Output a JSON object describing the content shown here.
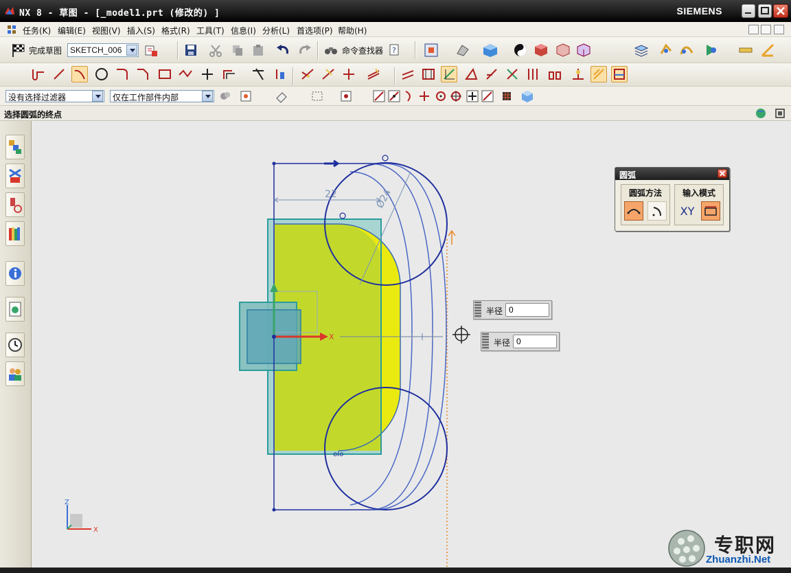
{
  "window": {
    "title": "NX 8 - 草图 - [_model1.prt  (修改的) ]",
    "brand": "SIEMENS"
  },
  "menubar": {
    "items": [
      "任务(K)",
      "编辑(E)",
      "视图(V)",
      "插入(S)",
      "格式(R)",
      "工具(T)",
      "信息(I)",
      "分析(L)",
      "首选项(P)",
      "帮助(H)"
    ]
  },
  "toolbar": {
    "finish_sketch_label": "完成草图",
    "sketch_name": "SKETCH_006",
    "command_finder_label": "命令查找器"
  },
  "selection_bar": {
    "type_filter": "没有选择过滤器",
    "scope": "仅在工作部件内部"
  },
  "cue_line": {
    "text": "选择圆弧的终点"
  },
  "arc_dialog": {
    "title": "圆弧",
    "group_method": "圆弧方法",
    "group_input": "输入模式",
    "xy_label": "XY"
  },
  "radius_inputs": [
    {
      "label": "半径",
      "value": "0"
    },
    {
      "label": "半径",
      "value": "0"
    }
  ],
  "sketch": {
    "dim_horizontal": "22",
    "dim_diameter": "Ø24",
    "axis_x": "X",
    "triad_z": "Z",
    "triad_x": "X"
  },
  "watermark": {
    "cn": "专职网",
    "en": "Zhuanzhi.Net"
  },
  "colors": {
    "accent_orange": "#f6a56a",
    "sketch_blue": "#1f2f9e",
    "body_yellow": "#c7d92a",
    "body_teal": "#7fbcbc"
  }
}
